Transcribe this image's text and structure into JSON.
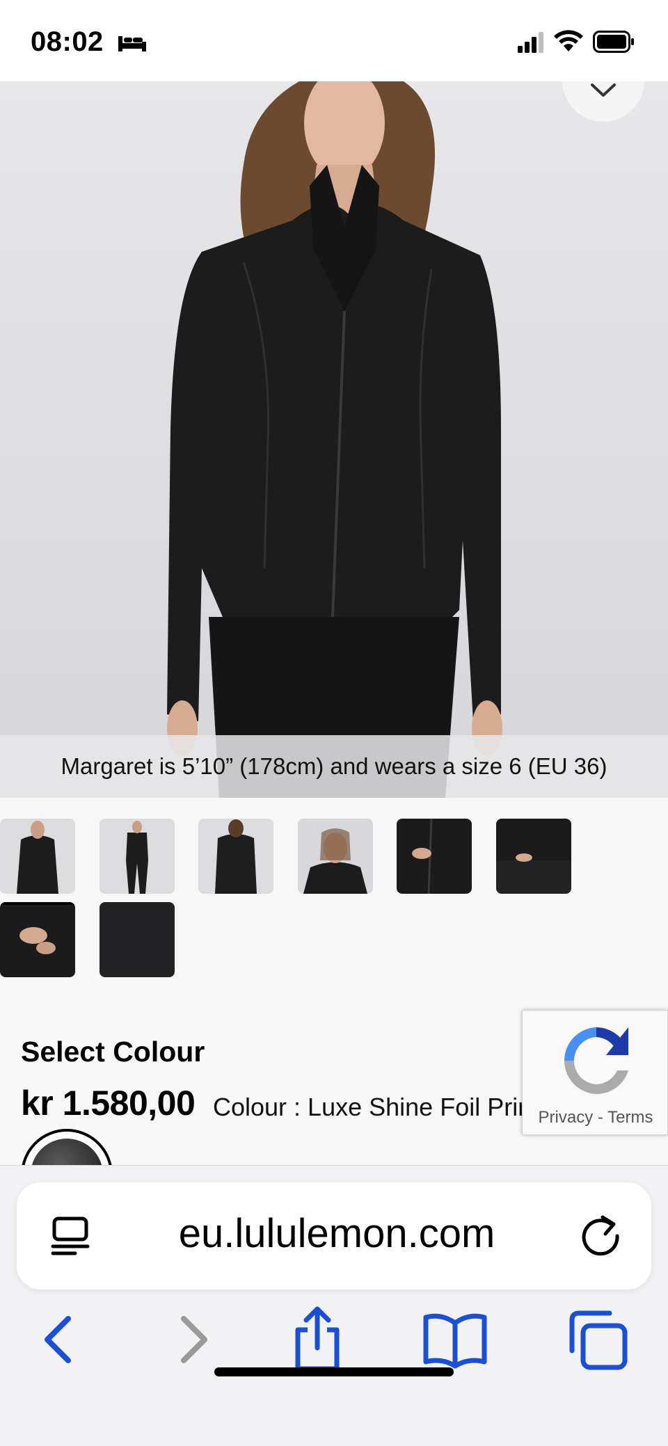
{
  "status_bar": {
    "time": "08:02",
    "icons": [
      "bed-icon",
      "cellular-signal-icon",
      "wifi-icon",
      "battery-icon"
    ]
  },
  "product": {
    "model_caption": "Margaret is 5’10” (178cm) and wears a size 6 (EU 36)",
    "select_colour_heading": "Select Colour",
    "price": "kr 1.580,00",
    "colour_label": "Colour : Luxe Shine Foil Prir",
    "thumbnails": [
      "front view",
      "full-length view",
      "back view",
      "collar close-up",
      "pocket close-up",
      "cuff close-up",
      "thumbhole close-up",
      "fabric swatch"
    ],
    "selected_thumbnail": 6
  },
  "recaptcha": {
    "privacy": "Privacy",
    "separator": "-",
    "terms": "Terms"
  },
  "browser": {
    "url": "eu.lululemon.com",
    "toolbar": [
      "back-icon",
      "forward-icon",
      "share-icon",
      "bookmarks-icon",
      "tabs-icon"
    ]
  },
  "colors": {
    "safari_accent": "#1a4fd6",
    "disabled": "#9a9a9a",
    "garment": "#1c1c1c"
  }
}
